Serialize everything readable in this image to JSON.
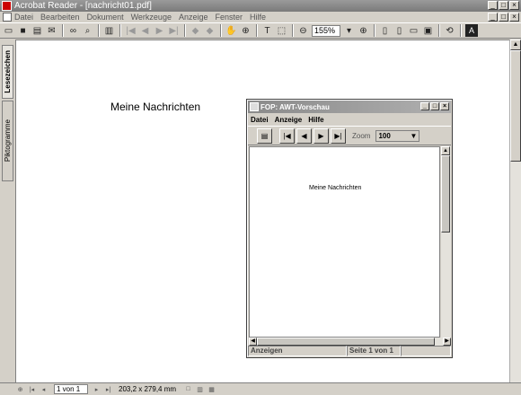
{
  "window": {
    "title": "Acrobat Reader - [nachricht01.pdf]"
  },
  "menubar": {
    "items": [
      "Datei",
      "Bearbeiten",
      "Dokument",
      "Werkzeuge",
      "Anzeige",
      "Fenster",
      "Hilfe"
    ]
  },
  "toolbar": {
    "zoom_value": "155%"
  },
  "sidebar": {
    "tabs": [
      "Lesezeichen",
      "Piktogramme"
    ]
  },
  "document": {
    "text": "Meine Nachrichten"
  },
  "statusbar": {
    "page": "1 von 1",
    "size": "203,2 x 279,4 mm"
  },
  "fop": {
    "title": "FOP: AWT-Vorschau",
    "menu": [
      "Datei",
      "Anzeige",
      "Hilfe"
    ],
    "zoom_label": "Zoom",
    "zoom_value": "100",
    "page_text": "Meine Nachrichten",
    "status_left": "Anzeigen",
    "status_page": "Seite 1 von 1"
  }
}
